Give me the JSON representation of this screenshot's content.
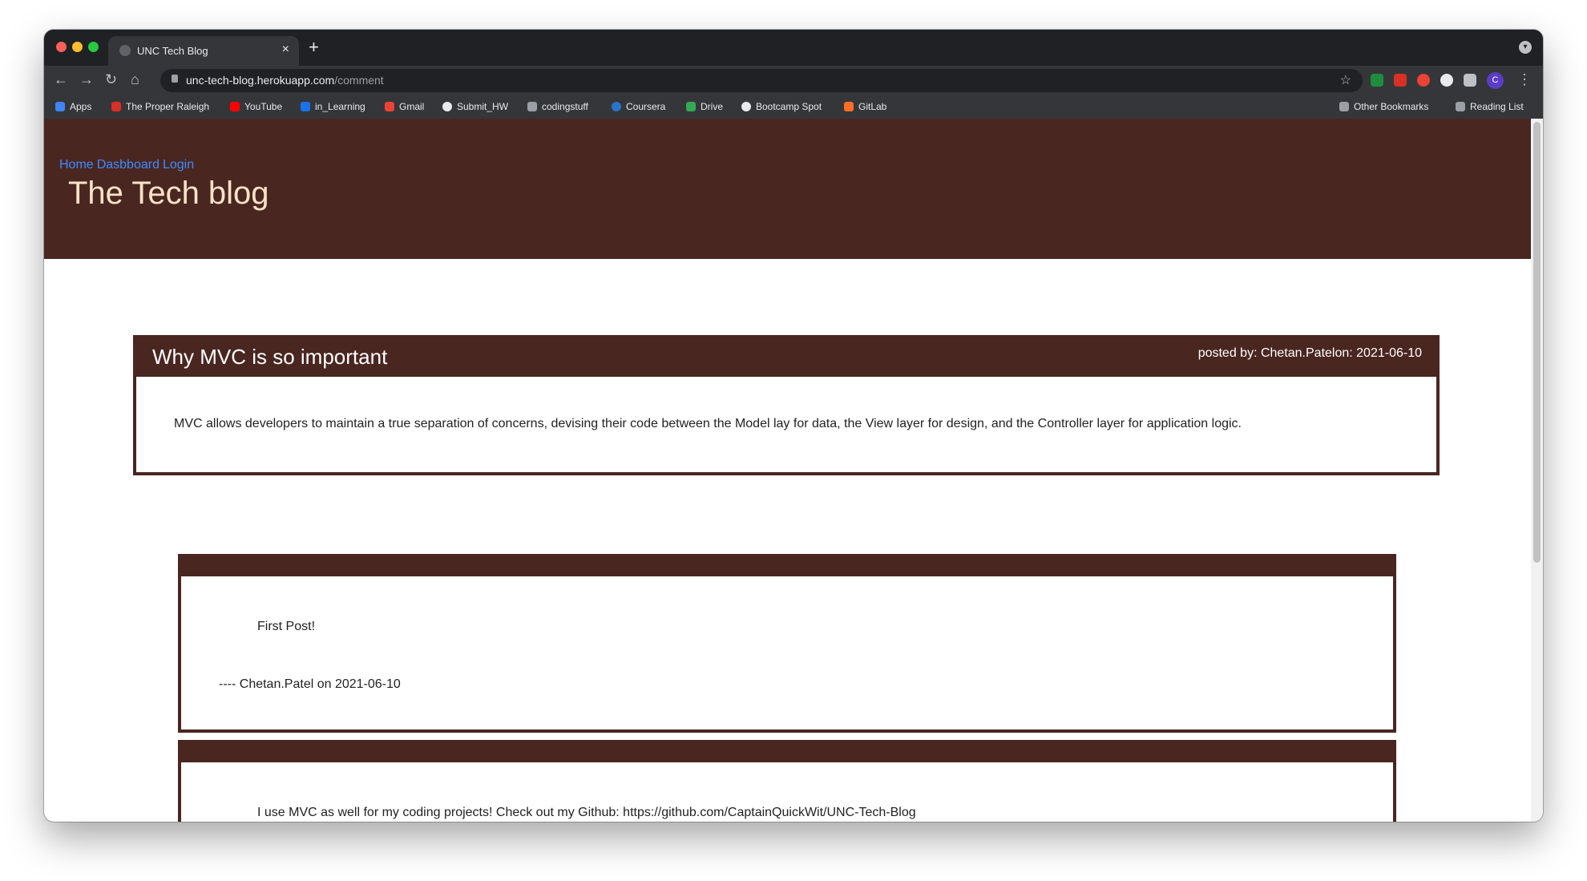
{
  "browser": {
    "tab_title": "UNC Tech Blog",
    "tab_close": "×",
    "new_tab": "+",
    "url_host": "unc-tech-blog.herokuapp.com",
    "url_path": "/comment",
    "profile_initial": "C"
  },
  "bookmarks": [
    {
      "label": "Apps",
      "color": "#4285f4"
    },
    {
      "label": "The Proper Raleigh",
      "color": "#d93025"
    },
    {
      "label": "YouTube",
      "color": "#ff0000"
    },
    {
      "label": "in_Learning",
      "color": "#1a73e8"
    },
    {
      "label": "Gmail",
      "color": "#ea4335"
    },
    {
      "label": "Submit_HW",
      "color": "#e8eaed"
    },
    {
      "label": "codingstuff",
      "color": "#9aa0a6"
    },
    {
      "label": "Coursera",
      "color": "#2a73cc"
    },
    {
      "label": "Drive",
      "color": "#34a853"
    },
    {
      "label": "Bootcamp Spot",
      "color": "#e8eaed"
    },
    {
      "label": "GitLab",
      "color": "#fc6d26"
    }
  ],
  "bookmarks_right": [
    {
      "label": "Other Bookmarks"
    },
    {
      "label": "Reading List"
    }
  ],
  "site": {
    "nav": [
      "Home",
      "Dasbboard",
      "Login"
    ],
    "title": "The Tech blog"
  },
  "post": {
    "title": "Why MVC is so important",
    "meta": "posted by: Chetan.Patelon: 2021-06-10",
    "body": "MVC allows developers to maintain a true separation of concerns, devising their code between the Model lay for data, the View layer for design, and the Controller layer for application logic."
  },
  "comments": [
    {
      "text": "First Post!",
      "signature": "---- Chetan.Patel on 2021-06-10"
    },
    {
      "text": "I use MVC as well for my coding projects! Check out my Github: https://github.com/CaptainQuickWit/UNC-Tech-Blog",
      "signature": ""
    }
  ]
}
